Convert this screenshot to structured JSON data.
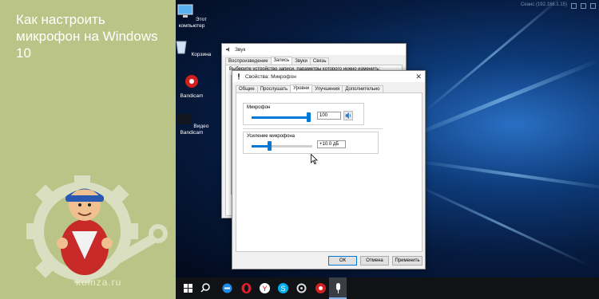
{
  "promo": {
    "title": "Как настроить микрофон на Windows 10",
    "site": "komza.ru"
  },
  "desktop": {
    "icons": [
      {
        "label": "Этот компьютер",
        "icon": "computer-icon"
      },
      {
        "label": "Корзина",
        "icon": "recycle-bin-icon"
      },
      {
        "label": "Bandicam",
        "icon": "bandicam-icon"
      },
      {
        "label": "Видео Bandicam",
        "icon": "video-folder-icon"
      }
    ],
    "top_right_text": "Сеанс (192.168.1.15)"
  },
  "sound_window": {
    "title": "Звук",
    "tabs": [
      "Воспроизведение",
      "Запись",
      "Звуки",
      "Связь"
    ],
    "active_tab": "Запись",
    "hint": "Выберите устройство записи, параметры которого нужно изменить:"
  },
  "props_window": {
    "title": "Свойства: Микрофон",
    "tabs": [
      "Общие",
      "Прослушать",
      "Уровни",
      "Улучшения",
      "Дополнительно"
    ],
    "active_tab": "Уровни",
    "mic": {
      "label": "Микрофон",
      "value": "100",
      "level": 1.0
    },
    "boost": {
      "label": "Усиление микрофона",
      "value": "+10.0 дБ",
      "level": 0.33
    },
    "buttons": {
      "ok": "ОК",
      "cancel": "Отмена",
      "apply": "Применить"
    }
  },
  "taskbar": {
    "icons": [
      "windows-start-icon",
      "search-icon",
      "edge-icon",
      "opera-icon",
      "yandex-icon",
      "skype-icon",
      "settings-icon",
      "bandicam-icon",
      "microphone-icon"
    ]
  },
  "colors": {
    "accent": "#0078d7",
    "promo_bg": "#b9c486",
    "taskbar": "#101216"
  }
}
